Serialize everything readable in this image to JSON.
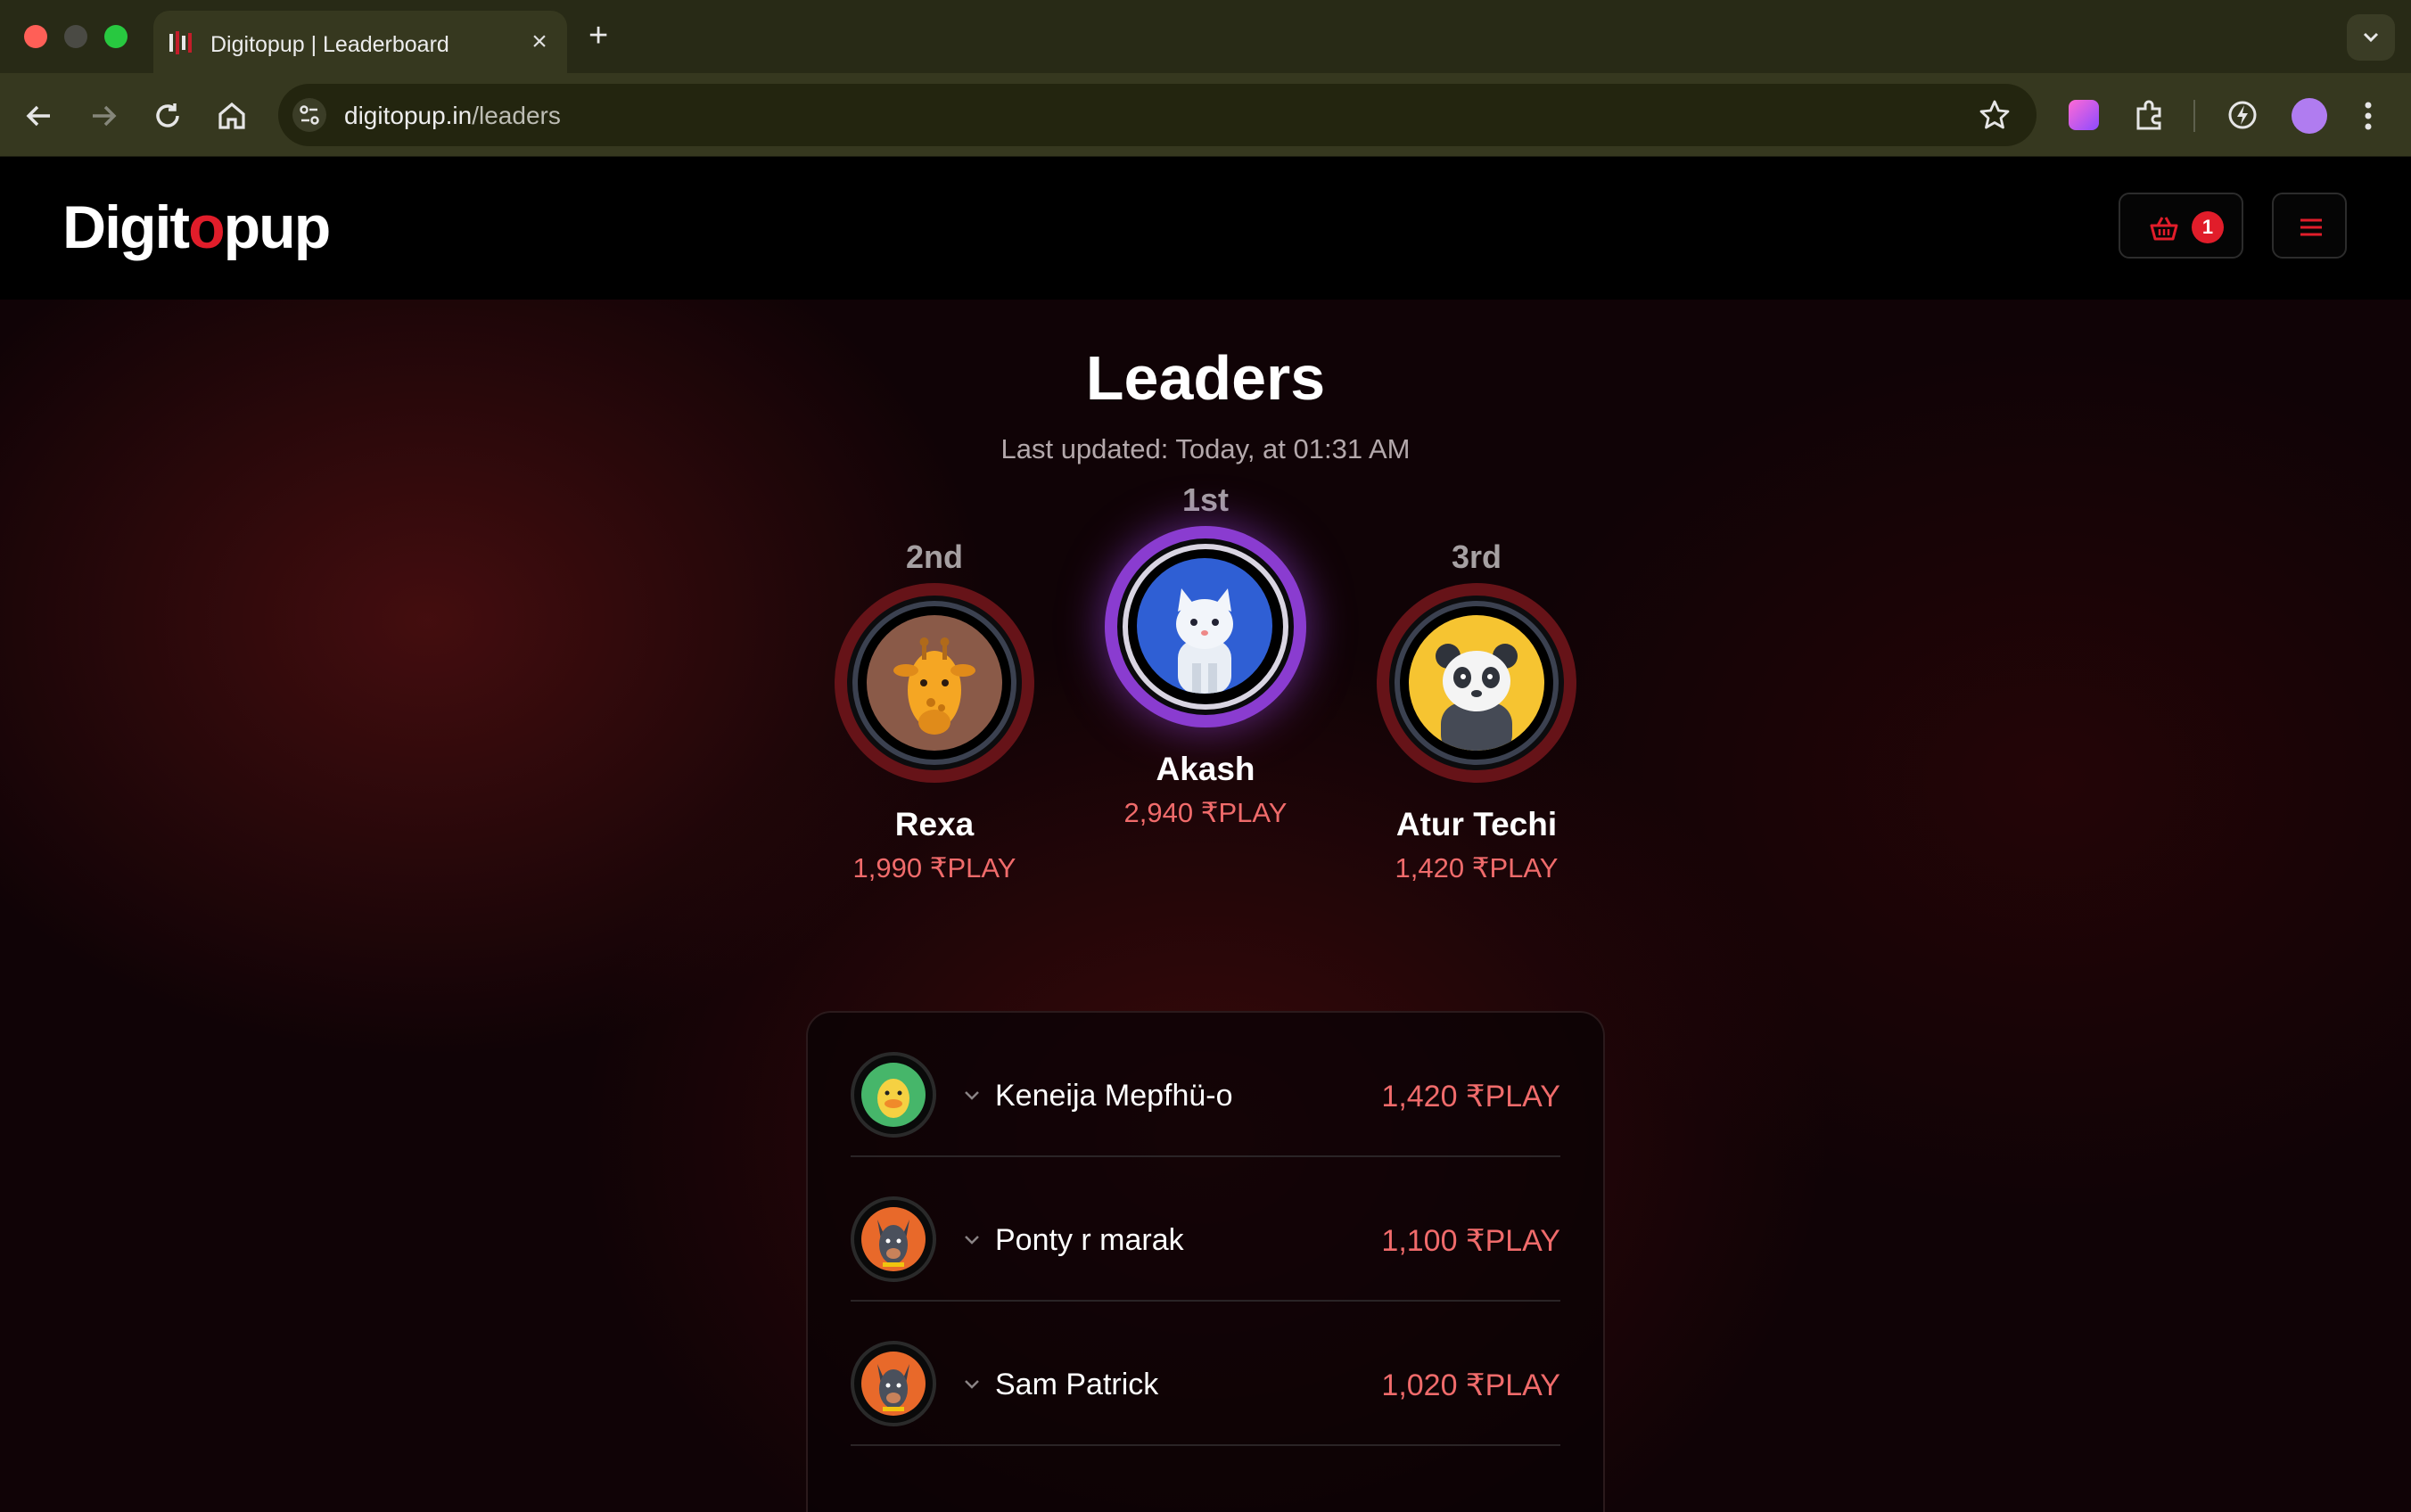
{
  "browser": {
    "tab_title": "Digitopup | Leaderboard",
    "tab_close": "×",
    "new_tab": "+",
    "url_domain": "digitopup.in",
    "url_path": "/leaders"
  },
  "header": {
    "logo_part1": "Digit",
    "logo_accent": "o",
    "logo_part2": "pup",
    "cart_count": "1"
  },
  "page": {
    "title": "Leaders",
    "last_updated": "Last updated: Today, at 01:31 AM"
  },
  "podium": [
    {
      "rank": "2nd",
      "name": "Rexa",
      "score": "1,990 ₹PLAY",
      "avatar": "giraffe-icon"
    },
    {
      "rank": "1st",
      "name": "Akash",
      "score": "2,940 ₹PLAY",
      "avatar": "white-cat-icon"
    },
    {
      "rank": "3rd",
      "name": "Atur Techi",
      "score": "1,420 ₹PLAY",
      "avatar": "panda-icon"
    }
  ],
  "leaders": [
    {
      "name": "Keneija Mepfhü-o",
      "score": "1,420 ₹PLAY",
      "avatar": "duck-icon"
    },
    {
      "name": "Ponty r marak",
      "score": "1,100 ₹PLAY",
      "avatar": "dog-icon"
    },
    {
      "name": "Sam Patrick",
      "score": "1,020 ₹PLAY",
      "avatar": "dog-icon"
    }
  ],
  "colors": {
    "accent": "#e11d2a",
    "score": "#f06b6b",
    "first_ring": "#8a3cd0",
    "podium_ring": "#661318"
  }
}
